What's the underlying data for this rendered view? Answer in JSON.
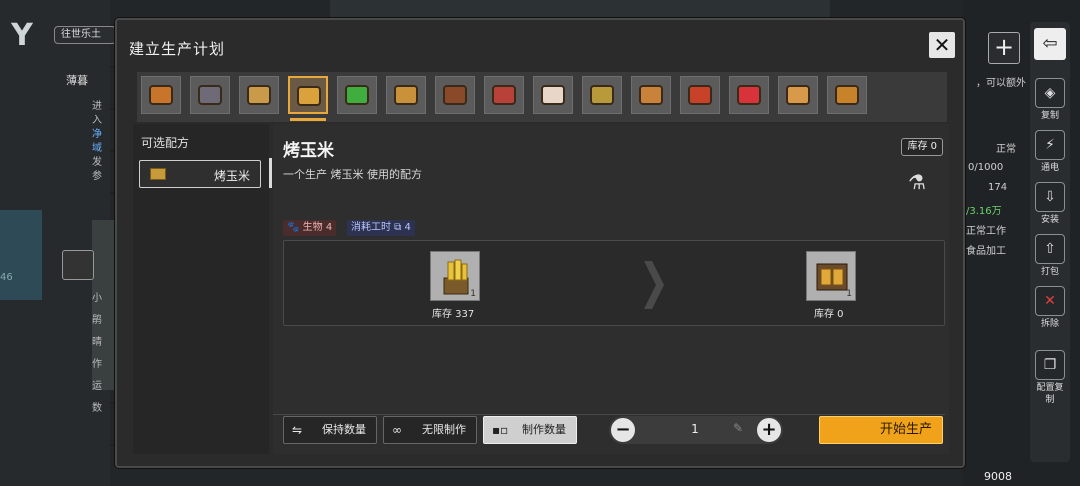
{
  "background": {
    "location_chip": "往世乐土",
    "left_texts": [
      "薄暮",
      "进入",
      "净域",
      "发参",
      "46",
      "小鹃",
      "晴作",
      "运数"
    ],
    "right_texts": {
      "hint": "，可以额外",
      "status": "正常",
      "capacity": "0/1000",
      "num": "174",
      "money": "/3.16万",
      "work": "正常工作",
      "category": "食品加工"
    },
    "bottom_number": "9008",
    "tools": [
      {
        "label": "复制",
        "icon": "◈"
      },
      {
        "label": "通电",
        "icon": "⚡"
      },
      {
        "label": "安装",
        "icon": "⇩"
      },
      {
        "label": "打包",
        "icon": "⇧"
      },
      {
        "label": "拆除",
        "icon": "✕"
      },
      {
        "label": "配置复制",
        "icon": "❐"
      }
    ]
  },
  "dialog": {
    "title": "建立生产计划",
    "close_icon": "✕",
    "recipe_strip": [
      {
        "name": "food-1",
        "color": "#c8742a"
      },
      {
        "name": "food-2",
        "color": "#6e6a78"
      },
      {
        "name": "food-3",
        "color": "#c89a4a"
      },
      {
        "name": "roast-corn",
        "color": "#d9a23a",
        "selected": true
      },
      {
        "name": "food-5",
        "color": "#3fae3f"
      },
      {
        "name": "food-6",
        "color": "#c9923a"
      },
      {
        "name": "food-7",
        "color": "#8a4a2a"
      },
      {
        "name": "food-8",
        "color": "#b8423a"
      },
      {
        "name": "food-9",
        "color": "#e8d6c8"
      },
      {
        "name": "food-10",
        "color": "#b89a3a"
      },
      {
        "name": "food-11",
        "color": "#c8823a"
      },
      {
        "name": "food-12",
        "color": "#c8422a"
      },
      {
        "name": "food-13",
        "color": "#d8323a"
      },
      {
        "name": "food-14",
        "color": "#d89a4a"
      },
      {
        "name": "food-15",
        "color": "#c8822a"
      }
    ],
    "left": {
      "title": "可选配方",
      "item_label": "烤玉米"
    },
    "main": {
      "title": "烤玉米",
      "stock_badge": "库存 0",
      "subtitle": "一个生产 烤玉米 使用的配方",
      "tag_bio": "生物 4",
      "tag_work": "消耗工时 ⧉ 4",
      "input": {
        "count": "1",
        "caption": "库存 337"
      },
      "output": {
        "count": "1",
        "caption": "库存 0"
      }
    },
    "controls": {
      "keep_qty": "保持数量",
      "infinite": "无限制作",
      "make_qty": "制作数量",
      "quantity": "1",
      "start": "开始生产"
    }
  }
}
